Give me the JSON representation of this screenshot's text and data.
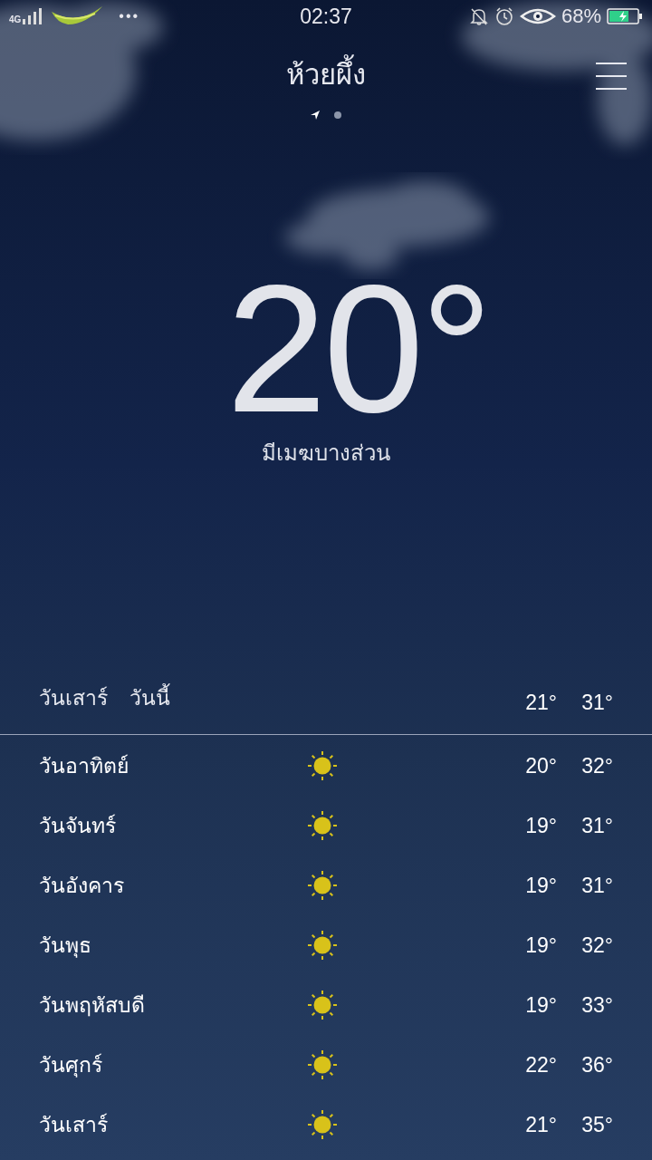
{
  "status_bar": {
    "network": "4G",
    "dots": "•••",
    "time": "02:37",
    "battery": "68%"
  },
  "location": "ห้วยผึ้ง",
  "pages": [
    {
      "kind": "location",
      "selected": true
    },
    {
      "kind": "dot",
      "selected": false
    }
  ],
  "current": {
    "temperature": "20°",
    "condition": "มีเมฆบางส่วน"
  },
  "today": {
    "day": "วันเสาร์",
    "label": "วันนี้",
    "low": "21°",
    "high": "31°"
  },
  "forecast": [
    {
      "day": "วันอาทิตย์",
      "kind": "sunny",
      "low": "20°",
      "high": "32°"
    },
    {
      "day": "วันจันทร์",
      "kind": "sunny",
      "low": "19°",
      "high": "31°"
    },
    {
      "day": "วันอังคาร",
      "kind": "sunny",
      "low": "19°",
      "high": "31°"
    },
    {
      "day": "วันพุธ",
      "kind": "sunny",
      "low": "19°",
      "high": "32°"
    },
    {
      "day": "วันพฤหัสบดี",
      "kind": "sunny",
      "low": "19°",
      "high": "33°"
    },
    {
      "day": "วันศุกร์",
      "kind": "sunny",
      "low": "22°",
      "high": "36°"
    },
    {
      "day": "วันเสาร์",
      "kind": "sunny",
      "low": "21°",
      "high": "35°"
    }
  ]
}
